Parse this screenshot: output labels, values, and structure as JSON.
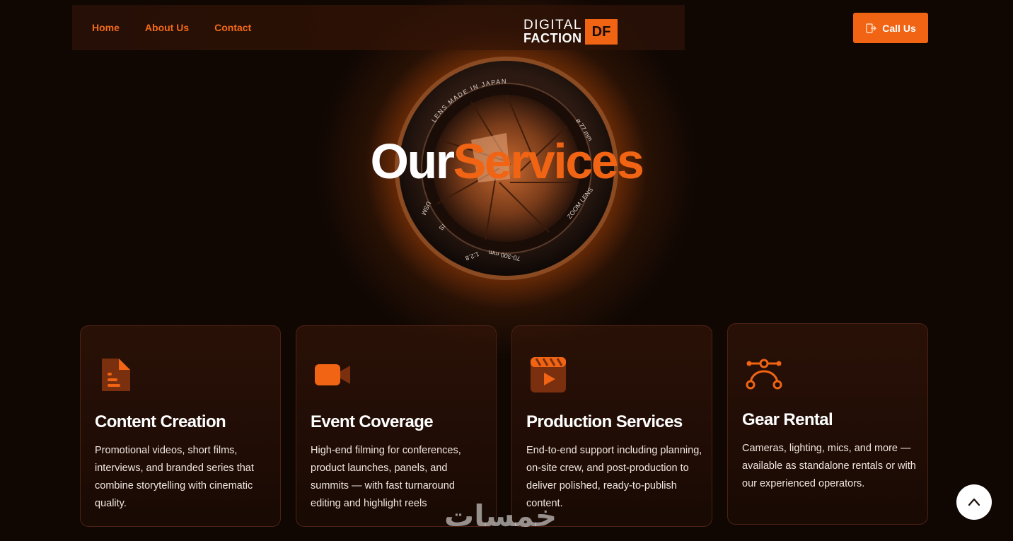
{
  "nav": {
    "links": [
      {
        "label": "Home"
      },
      {
        "label": "About Us"
      },
      {
        "label": "Contact"
      }
    ],
    "logo": {
      "line1": "DIGITAL",
      "line2": "FACTION",
      "mark": "DF"
    },
    "call_button": {
      "label": "Call Us",
      "icon": "exit-door-icon"
    }
  },
  "hero": {
    "title_part1": "Our",
    "title_part2": "Services",
    "lens": {
      "ring_top": "LENS MADE IN JAPAN",
      "ring_diameter": "ø 77 mm",
      "ring_zoom": "ZOOM LENS",
      "ring_focal": "70-300 mm",
      "ring_aperture": "1:2.8",
      "ring_is": "IS",
      "ring_usm": "USM"
    }
  },
  "services": [
    {
      "icon": "document-icon",
      "title": "Content Creation",
      "description": "Promotional videos, short films, interviews, and branded series that combine storytelling with cinematic quality."
    },
    {
      "icon": "video-camera-icon",
      "title": "Event Coverage",
      "description": "High-end filming for conferences, product launches, panels, and summits — with fast turnaround editing and highlight reels"
    },
    {
      "icon": "clapperboard-icon",
      "title": "Production Services",
      "description": "End-to-end support including planning, on-site crew, and post-production to deliver polished, ready-to-publish content."
    },
    {
      "icon": "bezier-curve-icon",
      "title": "Gear Rental",
      "description": "Cameras, lighting, mics, and more — available as standalone rentals or with our experienced operators."
    }
  ],
  "scroll_top": {
    "icon": "chevron-up-icon"
  },
  "watermark": "خمسات",
  "colors": {
    "accent": "#f06414",
    "background": "#140904",
    "text": "#ffffff"
  }
}
